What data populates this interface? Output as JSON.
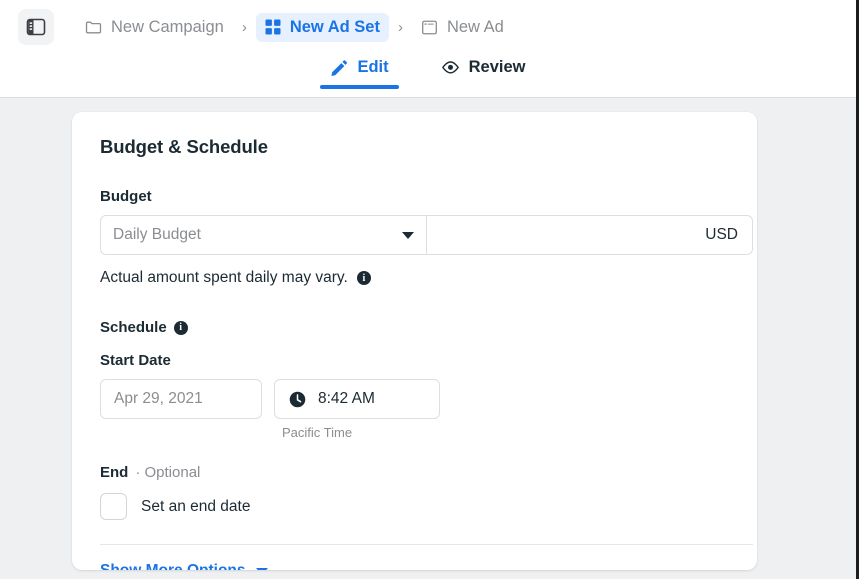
{
  "header": {
    "panel_toggle_icon": "sidebar-panel-icon",
    "breadcrumbs": [
      {
        "label": "New Campaign",
        "icon": "folder-icon",
        "active": false
      },
      {
        "label": "New Ad Set",
        "icon": "grid-icon",
        "active": true
      },
      {
        "label": "New Ad",
        "icon": "window-icon",
        "active": false
      }
    ],
    "separator": "›",
    "tabs": [
      {
        "label": "Edit",
        "icon": "pencil-icon",
        "active": true
      },
      {
        "label": "Review",
        "icon": "eye-icon",
        "active": false
      }
    ]
  },
  "card": {
    "title": "Budget & Schedule",
    "budget": {
      "label": "Budget",
      "select_value": "Daily Budget",
      "amount_value": "",
      "currency": "USD",
      "hint": "Actual amount spent daily may vary.",
      "hint_icon": "info-icon"
    },
    "schedule": {
      "label": "Schedule",
      "info_icon": "info-icon",
      "start_label": "Start Date",
      "date_value": "Apr 29, 2021",
      "time_value": "8:42 AM",
      "time_icon": "clock-icon",
      "timezone": "Pacific Time"
    },
    "end": {
      "label": "End",
      "optional": "· Optional",
      "checkbox_checked": false,
      "checkbox_label": "Set an end date"
    },
    "show_more": {
      "label": "Show More Options",
      "icon": "chevron-down-icon"
    }
  },
  "colors": {
    "accent": "#1b74e4",
    "accent_bg": "#e7f0fe",
    "text": "#1c2b33",
    "muted": "#8a8d91",
    "page_bg": "#eef0f2",
    "border": "#dcdee1"
  }
}
